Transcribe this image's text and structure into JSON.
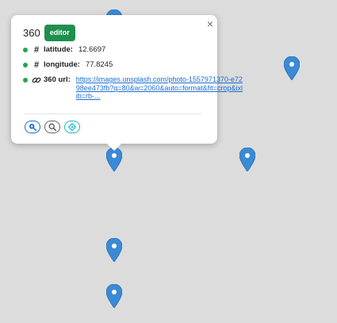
{
  "popup": {
    "title": "360",
    "badge": "editor",
    "close_glyph": "×",
    "fields": [
      {
        "icon": "hash-icon",
        "label": "latitude:",
        "value": "12.6697",
        "status_color": "#22a64d"
      },
      {
        "icon": "hash-icon",
        "label": "longitude:",
        "value": "77.8245",
        "status_color": "#22a64d"
      },
      {
        "icon": "link-icon",
        "label": "360 url:",
        "value": "https://images.unsplash.com/photo-1557971370-e7298ee473fb?q=80&w=2060&auto=format&fit=crop&ixlib=rb-...",
        "status_color": "#22a64d"
      }
    ],
    "actions": [
      {
        "icon": "zoom-to-icon",
        "color": "#1a6fd0"
      },
      {
        "icon": "search-icon",
        "color": "#666666"
      },
      {
        "icon": "crosshair-icon",
        "color": "#17b8c8"
      }
    ]
  },
  "map": {
    "background": "#dcdcdc",
    "marker_color": "#3a8ad6",
    "marker_count": 7
  },
  "colors": {
    "badge": "#1e8f4e",
    "link": "#1a6fd0"
  }
}
